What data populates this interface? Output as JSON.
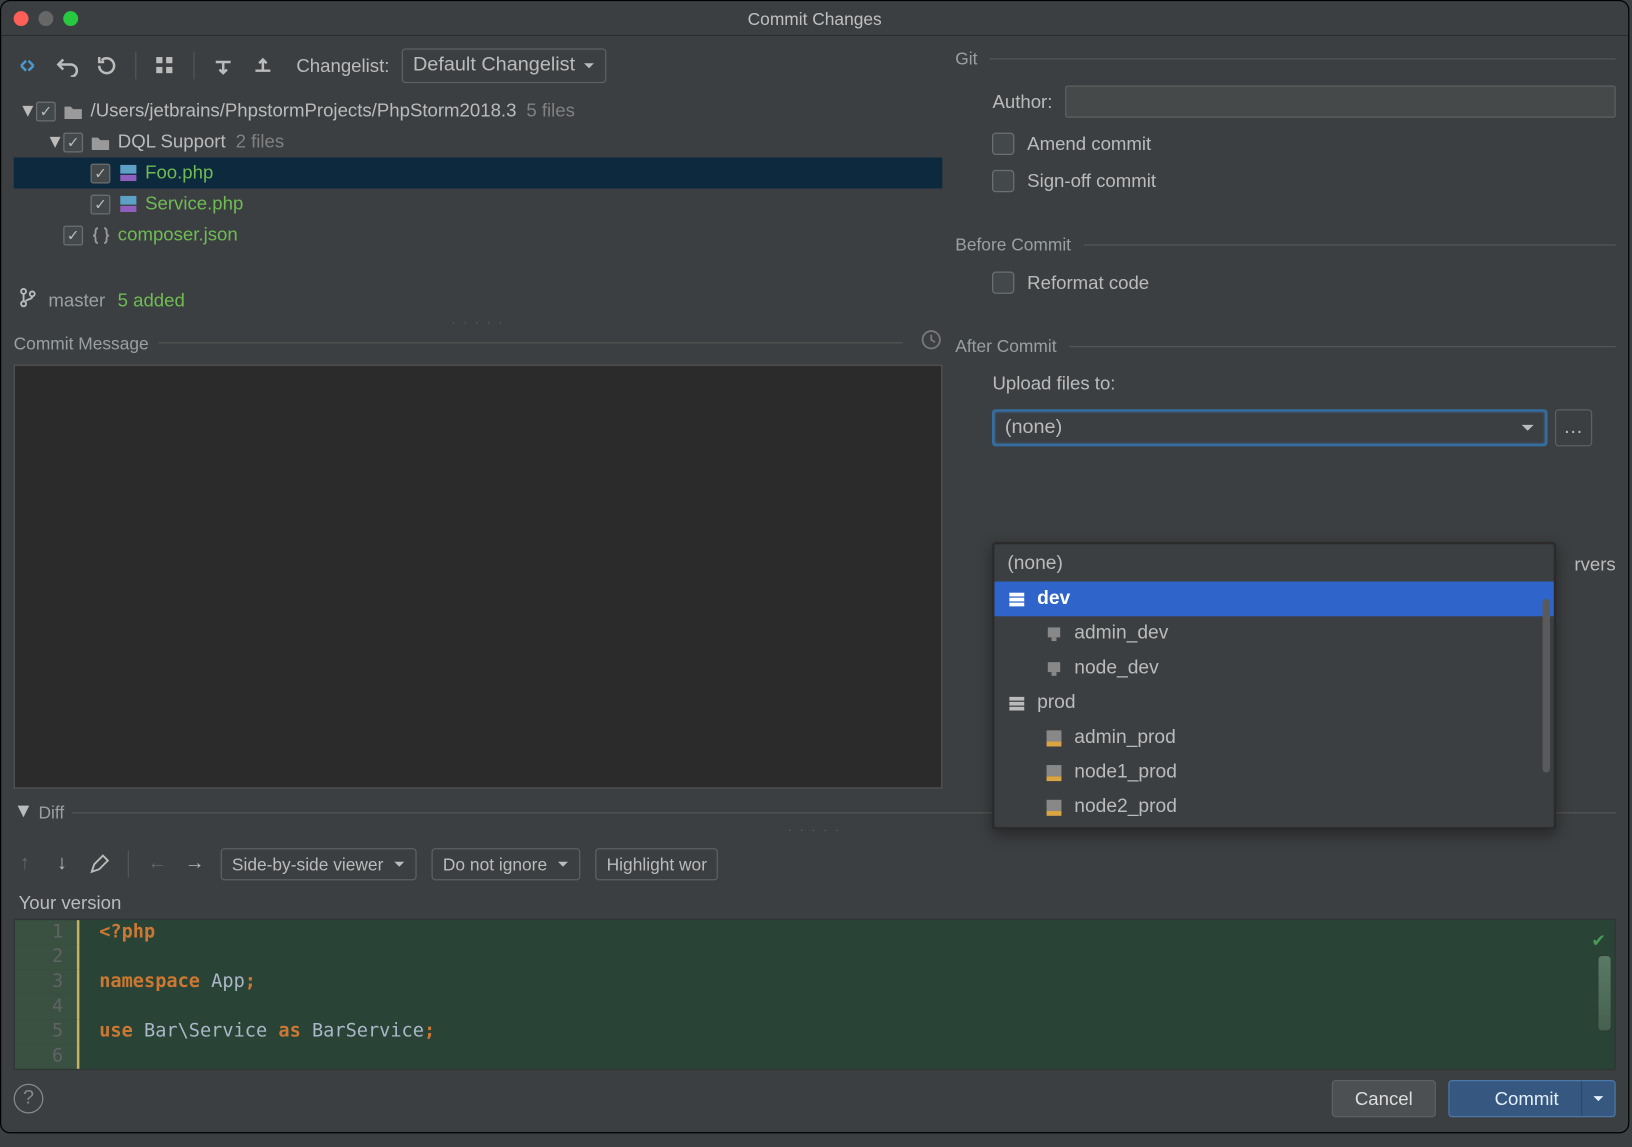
{
  "window_title": "Commit Changes",
  "toolbar": {
    "changelist_label": "Changelist:",
    "changelist_value": "Default Changelist"
  },
  "tree": {
    "root_path": "/Users/jetbrains/PhpstormProjects/PhpStorm2018.3",
    "root_count": "5 files",
    "folder1": "DQL Support",
    "folder1_count": "2 files",
    "file1": "Foo.php",
    "file2": "Service.php",
    "file3": "composer.json"
  },
  "branch": {
    "name": "master",
    "added": "5 added"
  },
  "commit_section": "Commit Message",
  "diff": {
    "label": "Diff",
    "view_mode": "Side-by-side viewer",
    "ignore_mode": "Do not ignore",
    "highlight_mode": "Highlight wor",
    "version_label": "Your version",
    "gutter": [
      "1",
      "2",
      "3",
      "4",
      "5",
      "6"
    ],
    "code": {
      "l1a": "<?php",
      "l3a": "namespace",
      "l3b": " App",
      "l3c": ";",
      "l5a": "use",
      "l5b": " Bar\\Service ",
      "l5c": "as",
      "l5d": " BarService",
      "l5e": ";"
    }
  },
  "git": {
    "heading": "Git",
    "author_label": "Author:",
    "amend_label": "Amend commit",
    "signoff_label": "Sign-off commit"
  },
  "before_commit": {
    "heading": "Before Commit",
    "reformat_label": "Reformat code"
  },
  "after_commit": {
    "heading": "After Commit",
    "upload_label": "Upload files to:",
    "upload_value": "(none)",
    "servers_peek": "rvers",
    "dropdown": [
      "(none)",
      "dev",
      "admin_dev",
      "node_dev",
      "prod",
      "admin_prod",
      "node1_prod",
      "node2_prod"
    ]
  },
  "footer": {
    "cancel": "Cancel",
    "commit": "Commit"
  }
}
